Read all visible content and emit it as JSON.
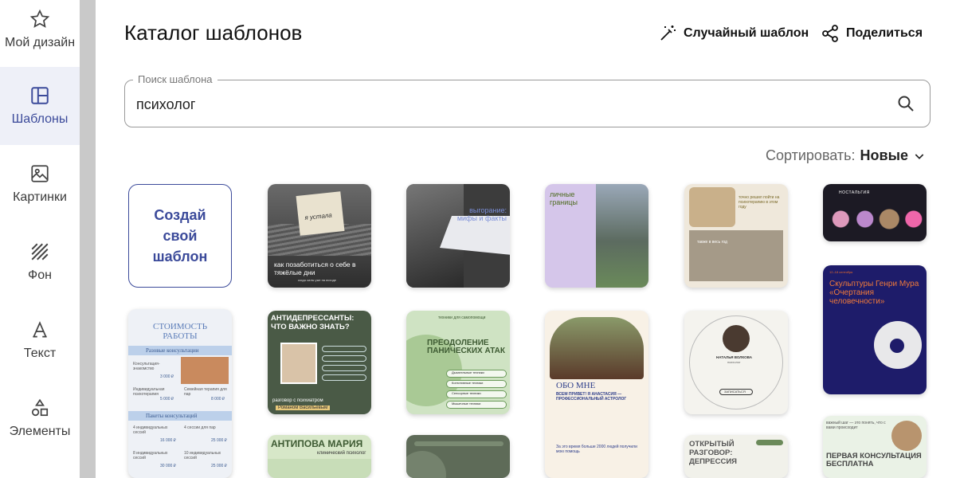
{
  "sidebar": {
    "items": [
      {
        "label": "Мой дизайн",
        "icon": "star-icon",
        "active": false
      },
      {
        "label": "Шаблоны",
        "icon": "template-icon",
        "active": true
      },
      {
        "label": "Картинки",
        "icon": "image-icon",
        "active": false
      },
      {
        "label": "Фон",
        "icon": "background-pattern-icon",
        "active": false
      },
      {
        "label": "Текст",
        "icon": "text-icon",
        "active": false
      },
      {
        "label": "Элементы",
        "icon": "shapes-icon",
        "active": false
      }
    ]
  },
  "header": {
    "title": "Каталог шаблонов",
    "random_label": "Случайный шаблон",
    "share_label": "Поделиться"
  },
  "search": {
    "legend": "Поиск шаблона",
    "value": "психолог"
  },
  "sort": {
    "label": "Сортировать:",
    "value": "Новые"
  },
  "create_card": {
    "label": "Создай свой шаблон"
  },
  "templates": {
    "t1": {
      "title": "как позаботиться о себе в тяжёлые дни",
      "note": "я устала",
      "sub": "когда силы уже на исходе"
    },
    "t2": {
      "title": "выгорание: мифы и факты"
    },
    "t3": {
      "title": "личные границы"
    },
    "t4": {
      "title": "точно решил пойти на психотерапию в этом году",
      "sub": "также в весь год"
    },
    "t5": {
      "title": "НОСТАЛЬГИЯ"
    },
    "t6": {
      "title": "СТОИМОСТЬ РАБОТЫ",
      "section1": "Разовые консультации",
      "section2": "Пакеты консультаций",
      "row1": "Консультация-знакомство",
      "price1": "3 000 ₽",
      "row2": "Индивидуальная психотерапия",
      "price2": "5 000 ₽",
      "row3": "Семейная терапия для пар",
      "price3": "8 000 ₽",
      "row4": "4 индивидуальных сессий",
      "price4": "16 000 ₽",
      "row5": "4 сессии для пар",
      "price5": "25 000 ₽",
      "row6": "8 индивидуальных сессий",
      "price6": "30 000 ₽",
      "row7": "10 индивидуальных сессий",
      "price7": "25 000 ₽"
    },
    "t7": {
      "title": "АНТИДЕПРЕССАНТЫ: ЧТО ВАЖНО ЗНАТЬ?",
      "sub": "разговор с психиатром",
      "name": "Романом Васильевым"
    },
    "t8": {
      "title": "ПРЕОДОЛЕНИЕ ПАНИЧЕСКИХ АТАК",
      "top": "техники для самопомощи",
      "items": [
        "Дыхательные техники",
        "Когнитивные техники",
        "Сенсорные техники",
        "Мышечные техники"
      ]
    },
    "t9": {
      "title": "ОБО МНЕ",
      "sub": "ВСЕМ ПРИВЕТ! Я АНАСТАСИЯ — ПРОФЕССИОНАЛЬНЫЙ АСТРОЛОГ",
      "foot": "За это время больше 2000 людей получили мою помощь"
    },
    "t10": {
      "title": "НАТАЛЬЯ ВОЛКОВА",
      "role": "психолог",
      "btn": "ЗАПИСАТЬСЯ"
    },
    "t11": {
      "title": "Скульптуры Генри Мура «Очертания человечности»",
      "date": "12–18 сентября"
    },
    "t12": {
      "title": "АНТИПОВА МАРИЯ",
      "sub": "клинический психолог"
    },
    "t14": {
      "title": "ОТКРЫТЫЙ РАЗГОВОР: ДЕПРЕССИЯ"
    },
    "t15": {
      "title": "ПЕРВАЯ КОНСУЛЬТАЦИЯ БЕСПЛАТНА",
      "top": "важный шаг — это понять, что с вами происходит"
    }
  }
}
